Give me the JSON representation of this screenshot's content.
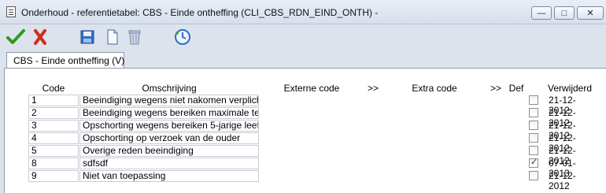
{
  "window": {
    "title": "Onderhoud - referentietabel: CBS - Einde ontheffing (CLI_CBS_RDN_EIND_ONTH) -",
    "controls": {
      "minimize": "—",
      "maximize": "□",
      "close": "✕"
    }
  },
  "toolbar": {
    "icons": [
      "confirm-check-icon",
      "cancel-x-icon",
      "save-icon",
      "new-document-icon",
      "delete-trash-icon",
      "refresh-clock-icon"
    ],
    "colors": {
      "check": "#2f9a1f",
      "cancel": "#d42b1e",
      "blue": "#2f6fc1"
    }
  },
  "tab": {
    "label": "CBS - Einde ontheffing (V)"
  },
  "table": {
    "headers": {
      "code": "Code",
      "omschrijving": "Omschrijving",
      "externe_code": "Externe code",
      "more1": ">>",
      "extra_code": "Extra code",
      "more2": ">>",
      "def": "Def",
      "verwijderd": "Verwijderd"
    },
    "rows": [
      {
        "code": "1",
        "omschrijving": "Beeindiging wegens niet nakomen verplich",
        "verwijderd_checked": false,
        "date": "21-12-2012"
      },
      {
        "code": "2",
        "omschrijving": "Beeindiging wegens bereiken maximale ter",
        "verwijderd_checked": false,
        "date": "21-12-2012"
      },
      {
        "code": "3",
        "omschrijving": "Opschorting wegens bereiken 5-jarige leeft",
        "verwijderd_checked": false,
        "date": "21-12-2012"
      },
      {
        "code": "4",
        "omschrijving": "Opschorting op verzoek van de ouder",
        "verwijderd_checked": false,
        "date": "21-12-2012"
      },
      {
        "code": "5",
        "omschrijving": "Overige reden beeindiging",
        "verwijderd_checked": false,
        "date": "21-12-2012"
      },
      {
        "code": "8",
        "omschrijving": "sdfsdf",
        "verwijderd_checked": true,
        "date": "07-01-2013"
      },
      {
        "code": "9",
        "omschrijving": "Niet van toepassing",
        "verwijderd_checked": false,
        "date": "21-12-2012"
      }
    ]
  }
}
